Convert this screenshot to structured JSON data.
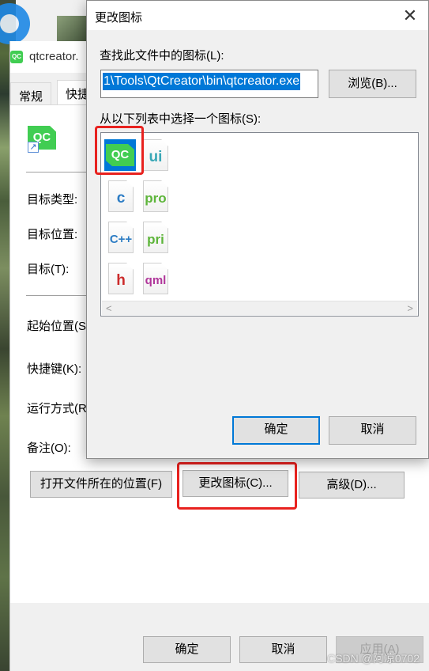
{
  "properties_window": {
    "title": "qtcreator.",
    "tabs": [
      {
        "label": "常规"
      },
      {
        "label": "快捷"
      }
    ],
    "fields": {
      "target_type": "目标类型:",
      "target_location": "目标位置:",
      "target": "目标(T):",
      "start_in": "起始位置(S)",
      "shortcut_key": "快捷键(K):",
      "run": "运行方式(R)",
      "comment": "备注(O):"
    },
    "buttons": {
      "open_location": "打开文件所在的位置(F)",
      "change_icon": "更改图标(C)...",
      "advanced": "高级(D)...",
      "ok": "确定",
      "cancel": "取消",
      "apply": "应用(A)"
    }
  },
  "dialog": {
    "title": "更改图标",
    "close_glyph": "✕",
    "find_label": "查找此文件中的图标(L):",
    "path_value": "1\\Tools\\QtCreator\\bin\\qtcreator.exe",
    "browse_button": "浏览(B)...",
    "list_label": "从以下列表中选择一个图标(S):",
    "icons": [
      {
        "name": "qc-icon",
        "text": "QC",
        "color": "#ffffff",
        "selected": true
      },
      {
        "name": "ui-file-icon",
        "text": "ui",
        "color": "#39a7b6",
        "selected": false
      },
      {
        "name": "c-file-icon",
        "text": "c",
        "color": "#2c7cc4",
        "selected": false
      },
      {
        "name": "pro-file-icon",
        "text": "pro",
        "color": "#5db53a",
        "selected": false
      },
      {
        "name": "cpp-file-icon",
        "text": "C++",
        "color": "#2c7cc4",
        "selected": false
      },
      {
        "name": "pri-file-icon",
        "text": "pri",
        "color": "#5db53a",
        "selected": false
      },
      {
        "name": "h-file-icon",
        "text": "h",
        "color": "#cc2b2b",
        "selected": false
      },
      {
        "name": "qml-file-icon",
        "text": "qml",
        "color": "#b0359a",
        "selected": false
      }
    ],
    "scroll_left": "<",
    "scroll_right": ">",
    "ok_button": "确定",
    "cancel_button": "取消"
  },
  "watermark": "CSDN @阿凉0702",
  "colors": {
    "qt_green": "#41cd52",
    "selection_blue": "#0078d7",
    "highlight_red": "#e8221f"
  }
}
